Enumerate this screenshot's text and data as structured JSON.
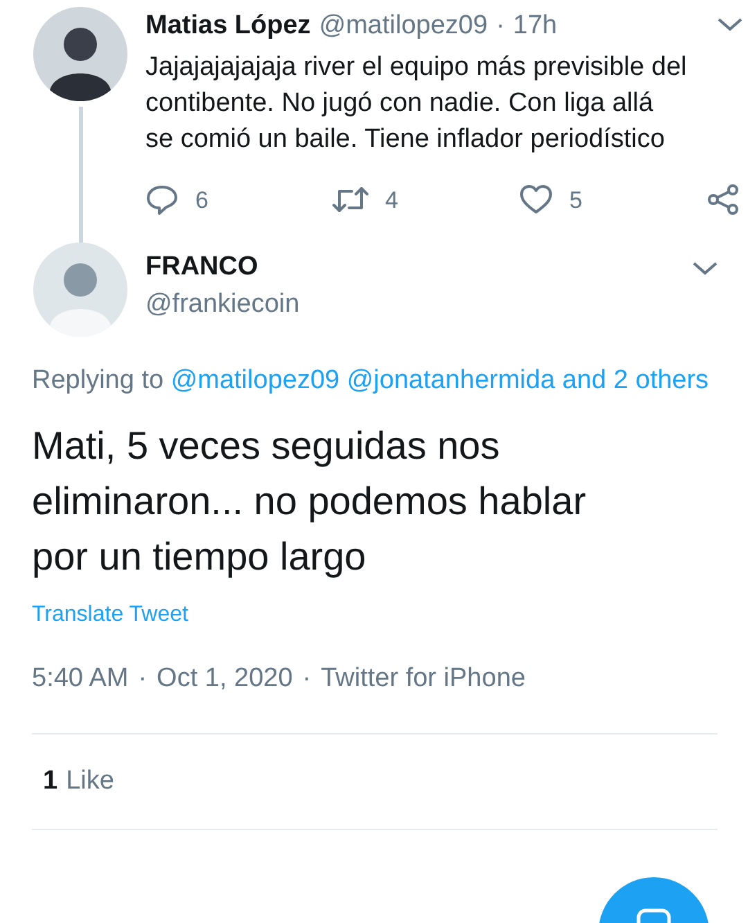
{
  "parent_tweet": {
    "name": "Matias López",
    "handle": "@matilopez09",
    "separator": "·",
    "time": "17h",
    "text": "Jajajajajajaja river el equipo más previsible del contibente. No jugó con nadie. Con liga allá se comió un baile. Tiene inflador periodístico",
    "actions": [
      {
        "kind": "reply",
        "count": "6"
      },
      {
        "kind": "retweet",
        "count": "4"
      },
      {
        "kind": "like",
        "count": "5"
      },
      {
        "kind": "share"
      }
    ]
  },
  "main_tweet": {
    "name": "FRANCO",
    "handle": "@frankiecoin",
    "replying_label": "Replying to",
    "mentions": [
      "@matilopez09",
      "@jonatanhermida"
    ],
    "others": "and 2 others",
    "text": "Mati, 5 veces seguidas nos eliminaron... no podemos hablar por un tiempo largo",
    "translate": "Translate Tweet",
    "time": "5:40 AM",
    "date": "Oct 1, 2020",
    "source": "Twitter for iPhone",
    "separator": "·",
    "likes_count": "1",
    "likes_label": "Like"
  }
}
